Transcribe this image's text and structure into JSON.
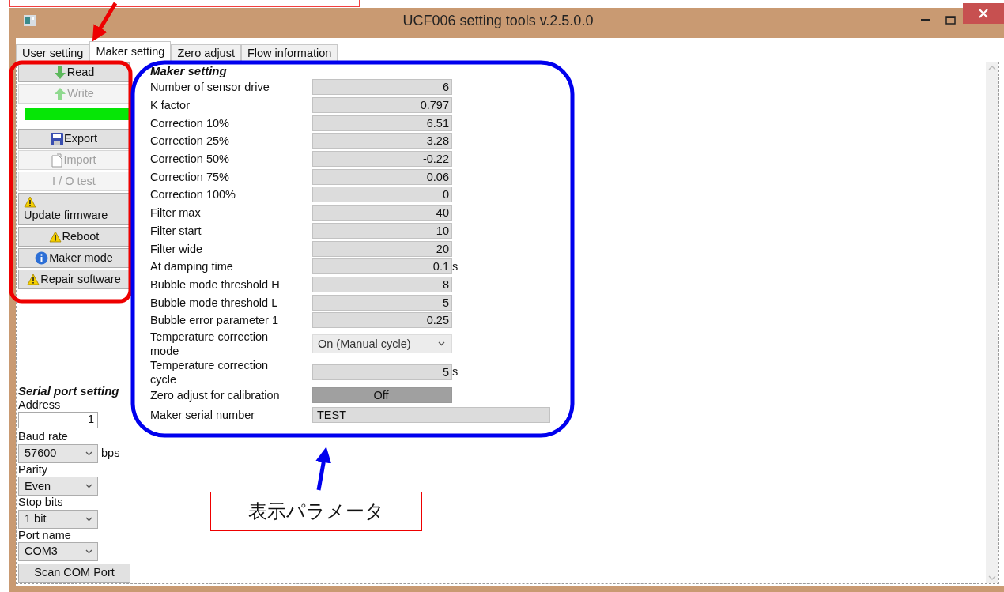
{
  "window": {
    "title": "UCF006 setting tools v.2.5.0.0"
  },
  "tabs": [
    {
      "label": "User setting",
      "selected": false
    },
    {
      "label": "Maker setting",
      "selected": true
    },
    {
      "label": "Zero adjust",
      "selected": false
    },
    {
      "label": "Flow information",
      "selected": false
    }
  ],
  "actions": [
    {
      "kind": "button",
      "label": "Read",
      "disabled": false
    },
    {
      "kind": "button",
      "label": "Write",
      "disabled": true
    },
    {
      "kind": "progress",
      "level": 1
    },
    {
      "kind": "button",
      "label": "Export",
      "disabled": false
    },
    {
      "kind": "button",
      "label": "Import",
      "disabled": true
    },
    {
      "kind": "button",
      "label": "I / O test",
      "disabled": true
    },
    {
      "kind": "button",
      "label": "Update firmware",
      "disabled": false
    },
    {
      "kind": "button",
      "label": "Reboot",
      "disabled": false
    },
    {
      "kind": "button",
      "label": "Maker mode",
      "disabled": false
    },
    {
      "kind": "button",
      "label": "Repair software",
      "disabled": false
    }
  ],
  "serial": {
    "title": "Serial port setting",
    "fields": [
      {
        "label": "Address",
        "kind": "input",
        "value": "1"
      },
      {
        "label": "Baud rate",
        "kind": "select",
        "value": "57600",
        "unit": "bps"
      },
      {
        "label": "Parity",
        "kind": "select",
        "value": "Even"
      },
      {
        "label": "Stop bits",
        "kind": "select",
        "value": "1 bit"
      },
      {
        "label": "Port name",
        "kind": "select",
        "value": "COM3"
      }
    ],
    "button": "Scan COM Port"
  },
  "maker": {
    "title": "Maker setting",
    "rows": [
      {
        "label": "Number of sensor drive",
        "kind": "number",
        "value": "6"
      },
      {
        "label": "K factor",
        "kind": "number",
        "value": "0.797"
      },
      {
        "label": "Correction 10%",
        "kind": "number",
        "value": "6.51"
      },
      {
        "label": "Correction 25%",
        "kind": "number",
        "value": "3.28"
      },
      {
        "label": "Correction 50%",
        "kind": "number",
        "value": "-0.22"
      },
      {
        "label": "Correction 75%",
        "kind": "number",
        "value": "0.06"
      },
      {
        "label": "Correction 100%",
        "kind": "number",
        "value": "0"
      },
      {
        "label": "Filter max",
        "kind": "number",
        "value": "40"
      },
      {
        "label": "Filter start",
        "kind": "number",
        "value": "10"
      },
      {
        "label": "Filter wide",
        "kind": "number",
        "value": "20"
      },
      {
        "label": "At damping time",
        "kind": "number",
        "value": "0.1",
        "unit": "s"
      },
      {
        "label": "Bubble mode threshold H",
        "kind": "number",
        "value": "8"
      },
      {
        "label": "Bubble mode threshold L",
        "kind": "number",
        "value": "5"
      },
      {
        "label": "Bubble error parameter 1",
        "kind": "number",
        "value": "0.25"
      },
      {
        "label": "Temperature correction mode",
        "kind": "select",
        "value": "On (Manual cycle)",
        "disabled": true
      },
      {
        "label": "Temperature correction cycle",
        "kind": "number",
        "value": "5",
        "unit": "s"
      },
      {
        "label": "Zero adjust for calibration",
        "kind": "toggle",
        "value": "Off",
        "on": false
      },
      {
        "label": "Maker serial number",
        "kind": "text",
        "value": "TEST"
      }
    ]
  },
  "callout": {
    "text": "表示パラメータ"
  }
}
